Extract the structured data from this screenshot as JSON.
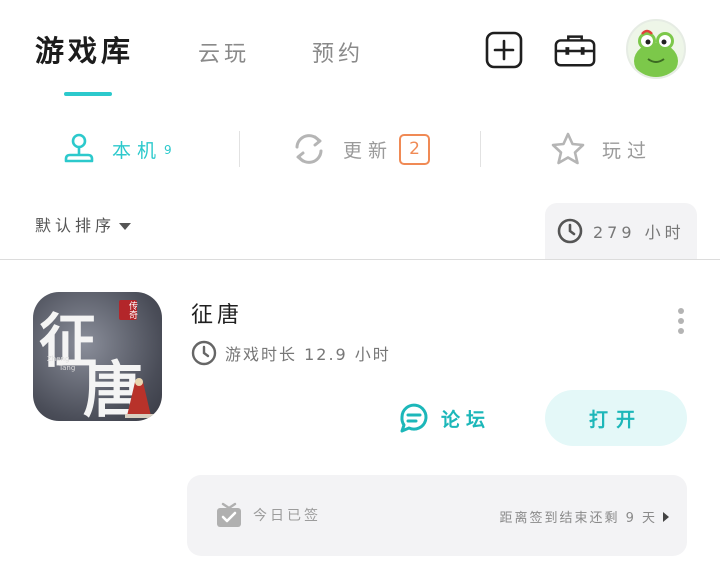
{
  "header": {
    "tabs": [
      {
        "label": "游戏库",
        "active": true
      },
      {
        "label": "云玩",
        "active": false
      },
      {
        "label": "预约",
        "active": false
      }
    ],
    "accent_color": "#2cc9cc"
  },
  "segments": {
    "local": {
      "label": "本机",
      "count": "9"
    },
    "update": {
      "label": "更新",
      "badge": "2"
    },
    "played": {
      "label": "玩过"
    }
  },
  "toolbar": {
    "sort_label": "默认排序",
    "total_time": "279 小时"
  },
  "game": {
    "title": "征唐",
    "icon_text": {
      "main1": "征",
      "main2": "唐",
      "seal": "传奇",
      "sub1": "Zheng",
      "sub2": "Tang"
    },
    "playtime": "游戏时长 12.9 小时",
    "forum_label": "论坛",
    "open_label": "打开"
  },
  "signin": {
    "status": "今日已签",
    "remaining": "距离签到结束还剩 9 天"
  }
}
